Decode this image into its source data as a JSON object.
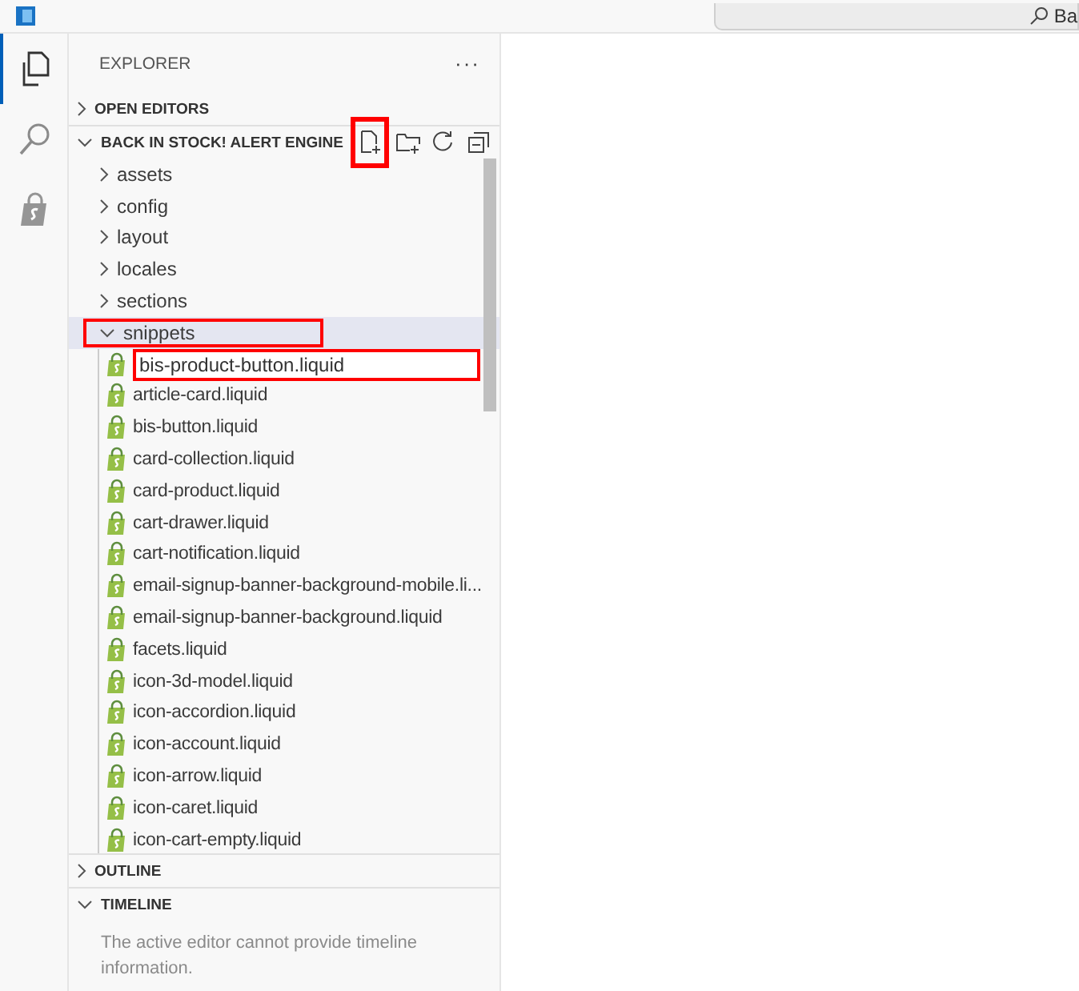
{
  "title_bar": {
    "search_text": "Ba"
  },
  "activity_bar": [
    {
      "kind": "files",
      "selected": true
    },
    {
      "kind": "search",
      "selected": false
    },
    {
      "kind": "shopify",
      "selected": false
    }
  ],
  "sidebar": {
    "title": "EXPLORER",
    "more": "···",
    "sections": [
      {
        "label": "OPEN EDITORS",
        "expanded": false
      },
      {
        "label": "BACK IN STOCK! ALERT ENGINE",
        "expanded": true,
        "actions": [
          {
            "kind": "new-file",
            "highlighted": true
          },
          {
            "kind": "new-folder",
            "highlighted": false
          },
          {
            "kind": "refresh",
            "highlighted": false
          },
          {
            "kind": "collapse",
            "highlighted": false
          }
        ],
        "tree": [
          {
            "kind": "folder",
            "label": "assets",
            "expanded": false,
            "selected": false,
            "highlighted": false
          },
          {
            "kind": "folder",
            "label": "config",
            "expanded": false,
            "selected": false,
            "highlighted": false
          },
          {
            "kind": "folder",
            "label": "layout",
            "expanded": false,
            "selected": false,
            "highlighted": false
          },
          {
            "kind": "folder",
            "label": "locales",
            "expanded": false,
            "selected": false,
            "highlighted": false
          },
          {
            "kind": "folder",
            "label": "sections",
            "expanded": false,
            "selected": false,
            "highlighted": false
          },
          {
            "kind": "folder",
            "label": "snippets",
            "expanded": true,
            "selected": true,
            "highlighted": true,
            "children": [
              {
                "kind": "new-file-input",
                "value": "bis-product-button.liquid",
                "highlighted": true
              },
              {
                "kind": "liquid",
                "label": "article-card.liquid"
              },
              {
                "kind": "liquid",
                "label": "bis-button.liquid"
              },
              {
                "kind": "liquid",
                "label": "card-collection.liquid"
              },
              {
                "kind": "liquid",
                "label": "card-product.liquid"
              },
              {
                "kind": "liquid",
                "label": "cart-drawer.liquid"
              },
              {
                "kind": "liquid",
                "label": "cart-notification.liquid"
              },
              {
                "kind": "liquid",
                "label": "email-signup-banner-background-mobile.li..."
              },
              {
                "kind": "liquid",
                "label": "email-signup-banner-background.liquid"
              },
              {
                "kind": "liquid",
                "label": "facets.liquid"
              },
              {
                "kind": "liquid",
                "label": "icon-3d-model.liquid"
              },
              {
                "kind": "liquid",
                "label": "icon-accordion.liquid"
              },
              {
                "kind": "liquid",
                "label": "icon-account.liquid"
              },
              {
                "kind": "liquid",
                "label": "icon-arrow.liquid"
              },
              {
                "kind": "liquid",
                "label": "icon-caret.liquid"
              },
              {
                "kind": "liquid",
                "label": "icon-cart-empty.liquid"
              }
            ]
          }
        ]
      },
      {
        "label": "OUTLINE",
        "expanded": false
      },
      {
        "label": "TIMELINE",
        "expanded": true,
        "message": "The active editor cannot provide timeline information."
      }
    ]
  }
}
